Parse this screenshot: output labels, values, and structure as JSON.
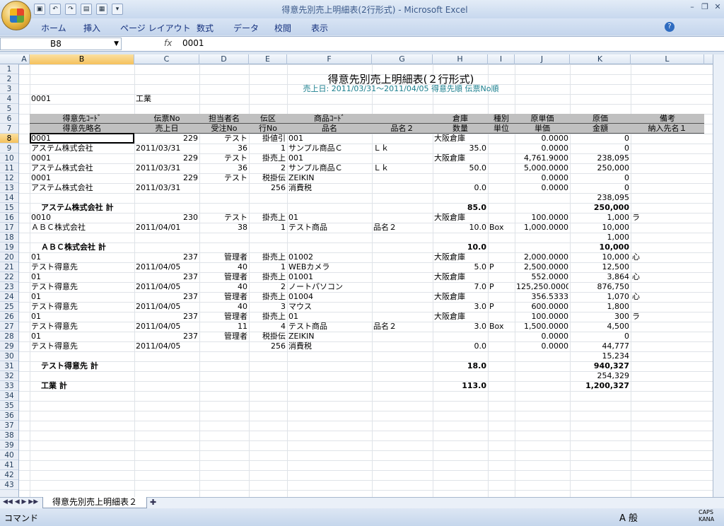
{
  "window": {
    "title": "得意先別売上明細表(2行形式) - Microsoft Excel",
    "min": "–",
    "restore": "❐",
    "close": "✕",
    "help": "?"
  },
  "ribbon": {
    "tabs": [
      "ホーム",
      "挿入",
      "ページ レイアウト",
      "数式",
      "データ",
      "校閲",
      "表示"
    ]
  },
  "formula_bar": {
    "name_box": "B8",
    "fx": "fx",
    "value": "0001"
  },
  "columns": [
    "A",
    "B",
    "C",
    "D",
    "E",
    "F",
    "G",
    "H",
    "I",
    "J",
    "K",
    "L"
  ],
  "selected_cell": {
    "col": "B",
    "row": 8
  },
  "rows": [
    "1",
    "2",
    "3",
    "4",
    "5",
    "6",
    "7",
    "8",
    "9",
    "10",
    "11",
    "12",
    "13",
    "14",
    "15",
    "16",
    "17",
    "18",
    "19",
    "20",
    "21",
    "22",
    "23",
    "24",
    "25",
    "26",
    "27",
    "28",
    "29",
    "30",
    "31",
    "32",
    "33",
    "34",
    "35",
    "36",
    "37",
    "38",
    "39",
    "40",
    "41",
    "42",
    "43"
  ],
  "report": {
    "title": "得意先別売上明細表(２行形式)",
    "subtitle": "売上日: 2011/03/31～2011/04/05 得意先順 伝票No順",
    "group_code": "0001",
    "group_name": "工業",
    "header1": [
      "得意先ｺｰﾄﾞ",
      "伝票No",
      "担当者名",
      "伝区",
      "商品ｺｰﾄﾞ",
      "",
      "倉庫",
      "種別",
      "原単価",
      "原価",
      "備考"
    ],
    "header2": [
      "得意先略名",
      "売上日",
      "受注No",
      "行No",
      "品名",
      "品名２",
      "数量",
      "単位",
      "単価",
      "金額",
      "納入先名１"
    ],
    "lines": [
      [
        "0001",
        "229",
        "テスト",
        "掛値引",
        "001",
        "",
        "大阪倉庫",
        "",
        "0.0000",
        "0",
        ""
      ],
      [
        "アステム株式会社",
        "2011/03/31",
        "36",
        "1",
        "サンプル商品Ｃ",
        "Ｌｋ",
        "35.0",
        "",
        "0.0000",
        "0",
        ""
      ],
      [
        "0001",
        "229",
        "テスト",
        "掛売上",
        "001",
        "",
        "大阪倉庫",
        "",
        "4,761.9000",
        "238,095",
        ""
      ],
      [
        "アステム株式会社",
        "2011/03/31",
        "36",
        "2",
        "サンプル商品Ｃ",
        "Ｌｋ",
        "50.0",
        "",
        "5,000.0000",
        "250,000",
        ""
      ],
      [
        "0001",
        "229",
        "テスト",
        "税掛伝",
        "ZEIKIN",
        "",
        "",
        "",
        "0.0000",
        "0",
        ""
      ],
      [
        "アステム株式会社",
        "2011/03/31",
        "",
        "256",
        "消費税",
        "",
        "0.0",
        "",
        "0.0000",
        "0",
        ""
      ],
      [
        "",
        "",
        "",
        "",
        "",
        "",
        "",
        "",
        "",
        "238,095",
        ""
      ],
      [
        "アステム株式会社 計",
        "",
        "",
        "",
        "",
        "",
        "85.0",
        "",
        "",
        "250,000",
        ""
      ],
      [
        "0010",
        "230",
        "テスト",
        "掛売上",
        "01",
        "",
        "大阪倉庫",
        "",
        "100.0000",
        "1,000",
        "ラ"
      ],
      [
        "ＡＢＣ株式会社",
        "2011/04/01",
        "38",
        "1",
        "テスト商品",
        "品名２",
        "10.0",
        "Box",
        "1,000.0000",
        "10,000",
        ""
      ],
      [
        "",
        "",
        "",
        "",
        "",
        "",
        "",
        "",
        "",
        "1,000",
        ""
      ],
      [
        "ＡＢＣ株式会社 計",
        "",
        "",
        "",
        "",
        "",
        "10.0",
        "",
        "",
        "10,000",
        ""
      ],
      [
        "01",
        "237",
        "管理者",
        "掛売上",
        "01002",
        "",
        "大阪倉庫",
        "",
        "2,000.0000",
        "10,000",
        "心"
      ],
      [
        "テスト得意先",
        "2011/04/05",
        "40",
        "1",
        "WEBカメラ",
        "",
        "5.0",
        "P",
        "2,500.0000",
        "12,500",
        ""
      ],
      [
        "01",
        "237",
        "管理者",
        "掛売上",
        "01001",
        "",
        "大阪倉庫",
        "",
        "552.0000",
        "3,864",
        "心"
      ],
      [
        "テスト得意先",
        "2011/04/05",
        "40",
        "2",
        "ノートパソコン",
        "",
        "7.0",
        "P",
        "125,250.0000",
        "876,750",
        ""
      ],
      [
        "01",
        "237",
        "管理者",
        "掛売上",
        "01004",
        "",
        "大阪倉庫",
        "",
        "356.5333",
        "1,070",
        "心"
      ],
      [
        "テスト得意先",
        "2011/04/05",
        "40",
        "3",
        "マウス",
        "",
        "3.0",
        "P",
        "600.0000",
        "1,800",
        ""
      ],
      [
        "01",
        "237",
        "管理者",
        "掛売上",
        "01",
        "",
        "大阪倉庫",
        "",
        "100.0000",
        "300",
        "ラ"
      ],
      [
        "テスト得意先",
        "2011/04/05",
        "11",
        "4",
        "テスト商品",
        "品名２",
        "3.0",
        "Box",
        "1,500.0000",
        "4,500",
        ""
      ],
      [
        "01",
        "237",
        "管理者",
        "税掛伝",
        "ZEIKIN",
        "",
        "",
        "",
        "0.0000",
        "0",
        ""
      ],
      [
        "テスト得意先",
        "2011/04/05",
        "",
        "256",
        "消費税",
        "",
        "0.0",
        "",
        "0.0000",
        "44,777",
        ""
      ],
      [
        "",
        "",
        "",
        "",
        "",
        "",
        "",
        "",
        "",
        "15,234",
        ""
      ],
      [
        "テスト得意先 計",
        "",
        "",
        "",
        "",
        "",
        "18.0",
        "",
        "",
        "940,327",
        ""
      ],
      [
        "",
        "",
        "",
        "",
        "",
        "",
        "",
        "",
        "",
        "254,329",
        ""
      ],
      [
        "工業 計",
        "",
        "",
        "",
        "",
        "",
        "113.0",
        "",
        "",
        "1,200,327",
        ""
      ]
    ]
  },
  "sheet_tabs": {
    "active": "得意先別売上明細表２",
    "new_sheet": "✚"
  },
  "status": {
    "mode": "コマンド",
    "ime": "A 般",
    "caps": "CAPS",
    "kana": "KANA"
  },
  "colors": {
    "header_fill": "#c0c0c0",
    "selection": "#f5c15c",
    "report_subtitle": "#1a7f8e"
  }
}
